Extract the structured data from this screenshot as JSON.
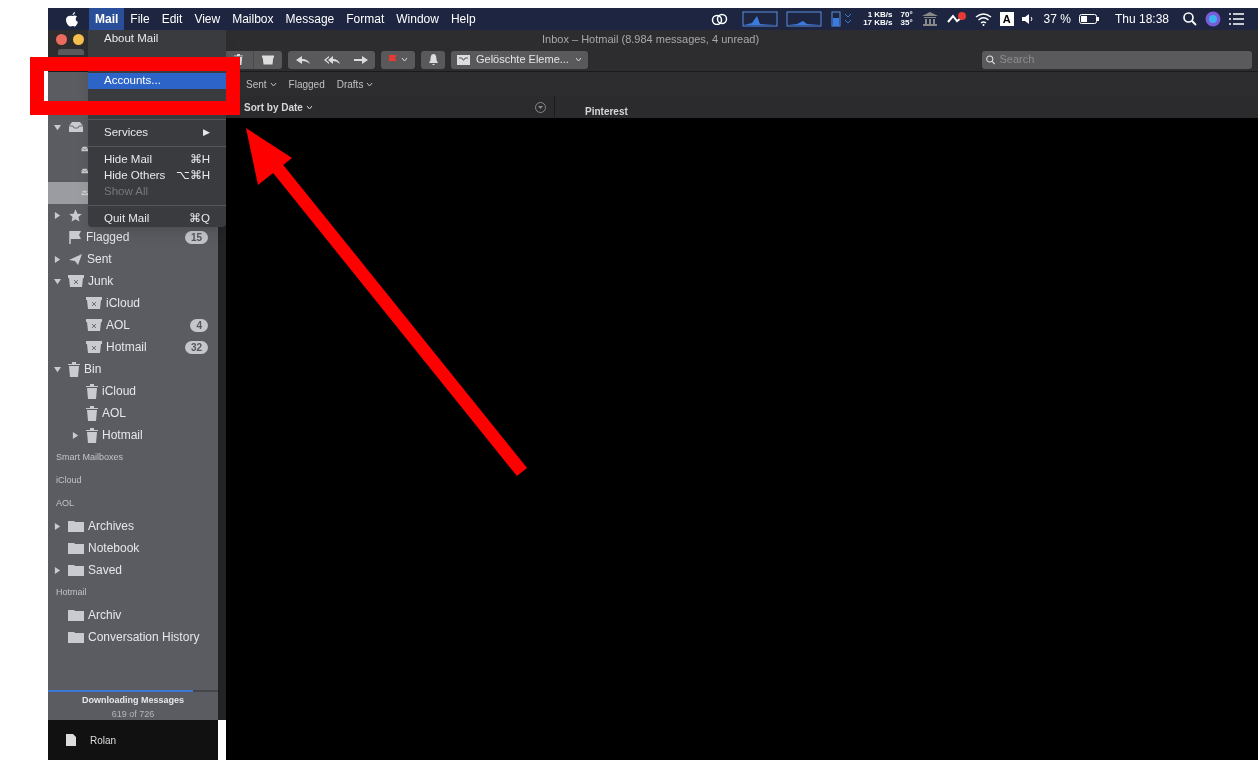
{
  "menu_bar": {
    "menus": [
      {
        "label": "Mail",
        "selected": true
      },
      {
        "label": "File",
        "selected": false
      },
      {
        "label": "Edit",
        "selected": false
      },
      {
        "label": "View",
        "selected": false
      },
      {
        "label": "Mailbox",
        "selected": false
      },
      {
        "label": "Message",
        "selected": false
      },
      {
        "label": "Format",
        "selected": false
      },
      {
        "label": "Window",
        "selected": false
      },
      {
        "label": "Help",
        "selected": false
      }
    ],
    "net_up": "1 KB/s",
    "net_down": "17 KB/s",
    "temp_1": "70°",
    "temp_2": "35°",
    "input_source": "A",
    "battery": "37 %",
    "clock": "Thu 18:38"
  },
  "mail_menu": {
    "items": [
      {
        "kind": "item",
        "label": "About Mail",
        "selected": false
      },
      {
        "kind": "hidden"
      },
      {
        "kind": "item",
        "label": "Accounts...",
        "selected": true
      },
      {
        "kind": "hidden"
      },
      {
        "kind": "separator"
      },
      {
        "kind": "submenu",
        "label": "Services",
        "arrow": "▶",
        "selected": false
      },
      {
        "kind": "separator"
      },
      {
        "kind": "item",
        "label": "Hide Mail",
        "shortcut": "⌘H",
        "selected": false
      },
      {
        "kind": "item",
        "label": "Hide Others",
        "shortcut": "⌥⌘H",
        "selected": false
      },
      {
        "kind": "item",
        "label": "Show All",
        "disabled": true,
        "selected": false
      },
      {
        "kind": "separator"
      },
      {
        "kind": "item",
        "label": "Quit Mail",
        "shortcut": "⌘Q",
        "selected": false
      }
    ]
  },
  "window": {
    "title": "Inbox – Hotmail (8.984 messages, 4 unread)"
  },
  "toolbar": {
    "mailbox_menu": "Gelöschte Eleme...",
    "search": {
      "placeholder": "Search"
    }
  },
  "favorites_bar": [
    {
      "label": "Sent",
      "menu": true
    },
    {
      "label": "Flagged",
      "menu": false
    },
    {
      "label": "Drafts",
      "menu": true
    }
  ],
  "message_list": {
    "sort": "Sort by Date"
  },
  "reading_pane": {
    "sender": "Pinterest"
  },
  "sidebar": {
    "covered_rows": [
      {
        "kind": "inbox",
        "expanded": true,
        "children": [
          {
            "kind": "inbox",
            "selected": false
          },
          {
            "kind": "inbox",
            "selected": false
          },
          {
            "kind": "inbox",
            "selected": true
          }
        ]
      },
      {
        "kind": "star",
        "expanded": false
      }
    ],
    "mailboxes": [
      {
        "label": "Flagged",
        "kind": "flag",
        "badge": "15"
      },
      {
        "label": "Sent",
        "kind": "sent",
        "expanded": false
      },
      {
        "label": "Junk",
        "kind": "junk",
        "expanded": true,
        "children": [
          {
            "label": "iCloud",
            "kind": "junk"
          },
          {
            "label": "AOL",
            "kind": "junk",
            "badge": "4"
          },
          {
            "label": "Hotmail",
            "kind": "junk",
            "badge": "32"
          }
        ]
      },
      {
        "label": "Bin",
        "kind": "bin",
        "expanded": true,
        "children": [
          {
            "label": "iCloud",
            "kind": "bin"
          },
          {
            "label": "AOL",
            "kind": "bin"
          },
          {
            "label": "Hotmail",
            "kind": "bin",
            "expanded": false
          }
        ]
      }
    ],
    "sections": [
      {
        "title": "Smart Mailboxes"
      },
      {
        "title": "iCloud"
      },
      {
        "title": "AOL",
        "items": [
          {
            "label": "Archives",
            "kind": "folder",
            "expanded": false
          },
          {
            "label": "Notebook",
            "kind": "folder"
          },
          {
            "label": "Saved",
            "kind": "folder",
            "expanded": false
          }
        ]
      },
      {
        "title": "Hotmail",
        "items": [
          {
            "label": "Archiv",
            "kind": "folder"
          },
          {
            "label": "Conversation History",
            "kind": "folder"
          }
        ]
      }
    ],
    "activity": {
      "title": "Downloading Messages",
      "detail": "619 of 726",
      "level": 0.85
    }
  },
  "dock": {
    "item": "Rolan"
  }
}
